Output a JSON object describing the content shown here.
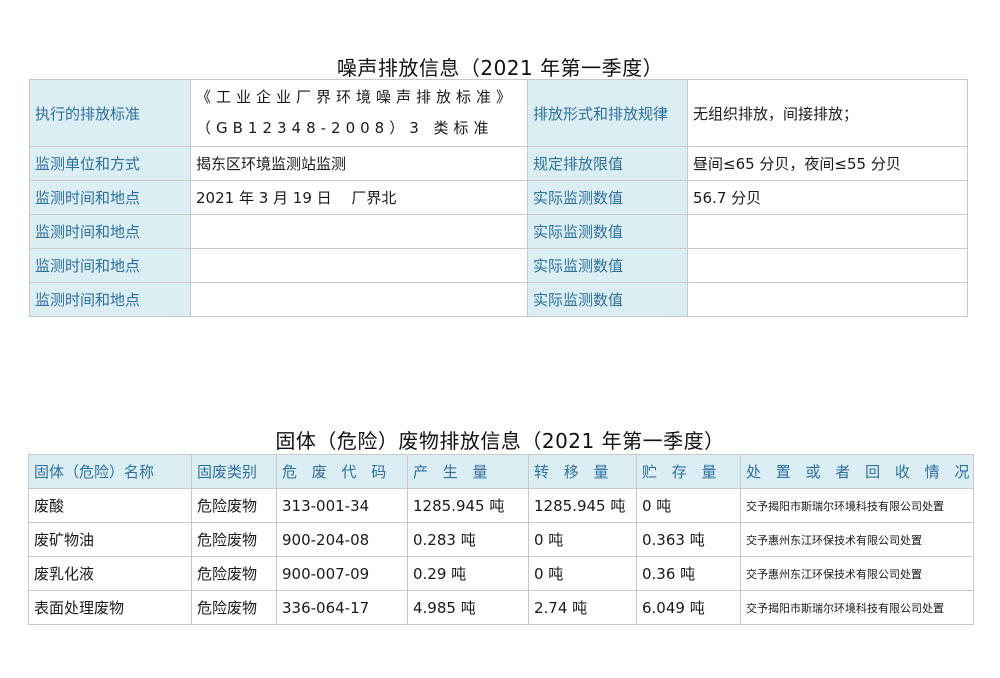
{
  "noise": {
    "title": "噪声排放信息（2021 年第一季度）",
    "standard_label": "执行的排放标准",
    "standard_value": "《工业企业厂界环境噪声排放标准》（GB12348-2008）3 类标准",
    "form_label": "排放形式和排放规律",
    "form_value": "无组织排放，间接排放；",
    "unit_label": "监测单位和方式",
    "unit_value": "揭东区环境监测站监测",
    "limit_label": "规定排放限值",
    "limit_value": "昼间≤65 分贝，夜间≤55 分贝",
    "rows": [
      {
        "label": "监测时间和地点",
        "value": "2021 年 3 月 19 日　 厂界北",
        "result_label": "实际监测数值",
        "result": "56.7 分贝"
      },
      {
        "label": "监测时间和地点",
        "value": "",
        "result_label": "实际监测数值",
        "result": ""
      },
      {
        "label": "监测时间和地点",
        "value": "",
        "result_label": "实际监测数值",
        "result": ""
      },
      {
        "label": "监测时间和地点",
        "value": "",
        "result_label": "实际监测数值",
        "result": ""
      }
    ]
  },
  "waste": {
    "title": "固体（危险）废物排放信息（2021 年第一季度）",
    "headers": [
      "固体（危险）名称",
      "固废类别",
      "危 废 代 码",
      "产 生 量",
      "转 移 量",
      "贮 存 量",
      "处 置 或 者 回 收 情 况"
    ],
    "rows": [
      [
        "废酸",
        "危险废物",
        "313-001-34",
        "1285.945 吨",
        "1285.945 吨",
        " 0 吨",
        "交予揭阳市斯瑞尔环境科技有限公司处置"
      ],
      [
        "废矿物油",
        "危险废物",
        "900-204-08",
        "0.283 吨",
        "0 吨",
        "0.363 吨",
        "交予惠州东江环保技术有限公司处置"
      ],
      [
        "废乳化液",
        "危险废物",
        "900-007-09",
        "0.29 吨",
        "0 吨",
        "0.36 吨",
        "交予惠州东江环保技术有限公司处置"
      ],
      [
        "表面处理废物",
        "危险废物",
        "336-064-17",
        "4.985 吨",
        "2.74 吨",
        "6.049 吨",
        "交予揭阳市斯瑞尔环境科技有限公司处置"
      ]
    ]
  }
}
